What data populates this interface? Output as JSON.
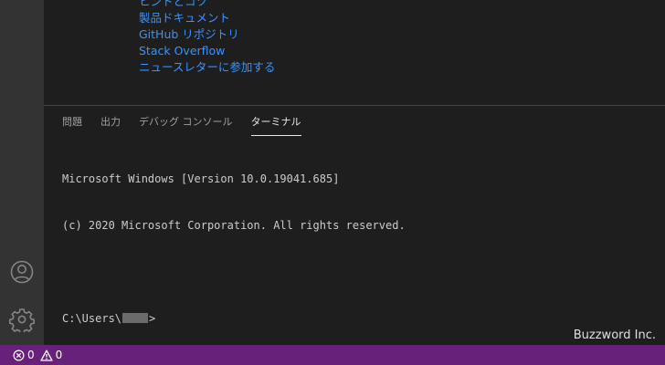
{
  "welcome": {
    "links": [
      "ヒントとコツ",
      "製品ドキュメント",
      "GitHub リポジトリ",
      "Stack Overflow",
      "ニュースレターに参加する"
    ]
  },
  "panel": {
    "tabs": [
      "問題",
      "出力",
      "デバッグ コンソール",
      "ターミナル"
    ],
    "active_tab": "ターミナル"
  },
  "terminal": {
    "line1": "Microsoft Windows [Version 10.0.19041.685]",
    "line2": "(c) 2020 Microsoft Corporation. All rights reserved.",
    "prompt_prefix": "C:\\Users\\",
    "prompt_suffix": ">"
  },
  "watermark": "Buzzword Inc.",
  "status_bar": {
    "errors": "0",
    "warnings": "0",
    "color": "#68217a"
  },
  "icons": {
    "account": "account-icon",
    "settings": "gear-icon",
    "error": "error-icon",
    "warning": "warning-icon"
  }
}
